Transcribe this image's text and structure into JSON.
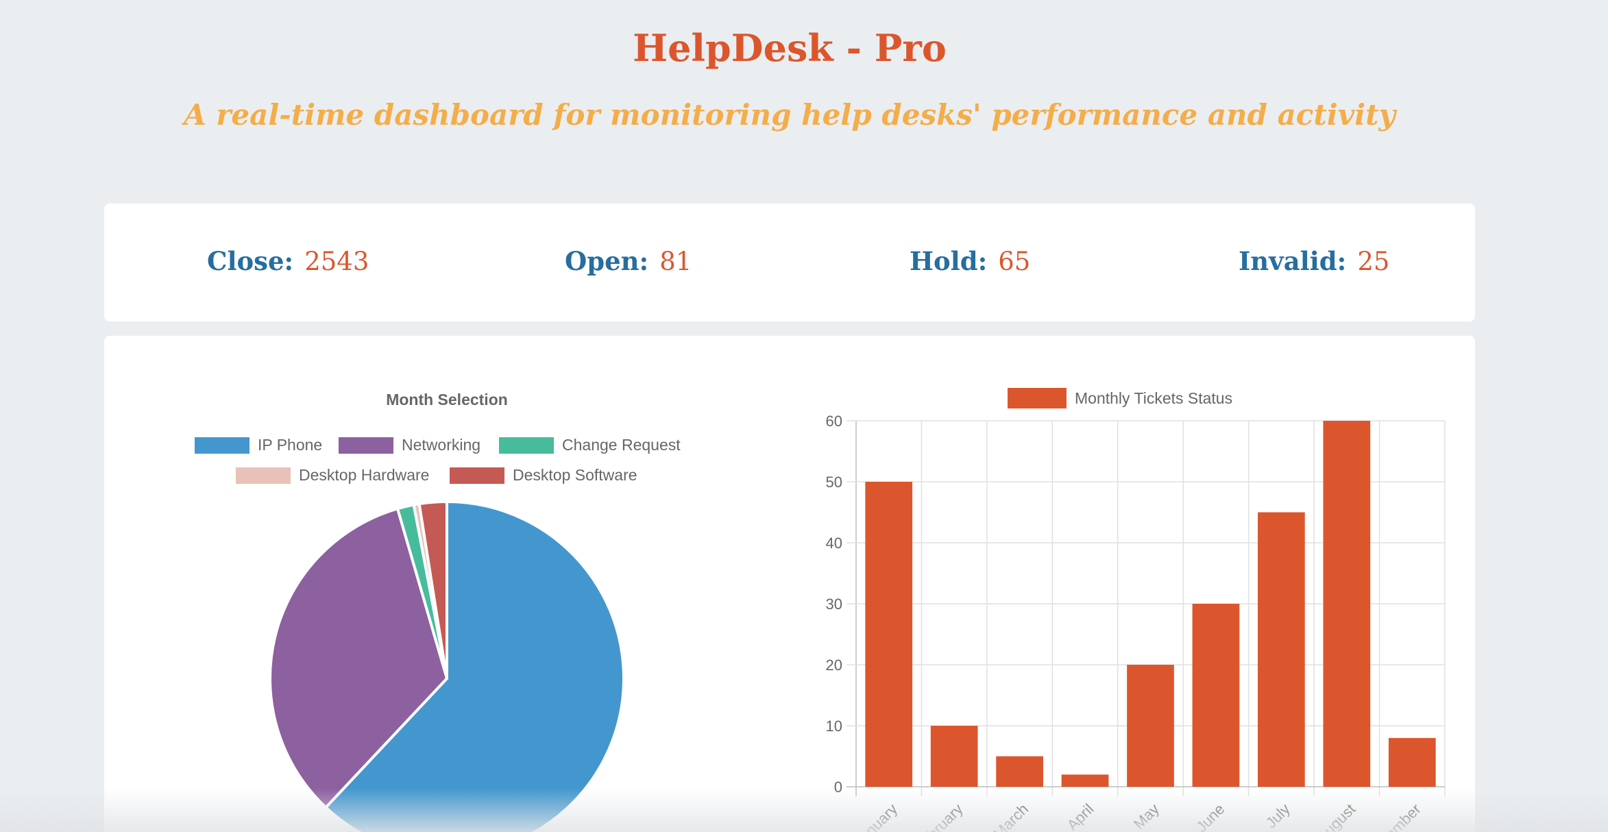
{
  "header": {
    "title": "HelpDesk - Pro",
    "subtitle": "A real-time dashboard for monitoring help desks' performance and activity"
  },
  "stats": [
    {
      "label": "Close:",
      "value": "2543"
    },
    {
      "label": "Open:",
      "value": "81"
    },
    {
      "label": "Hold:",
      "value": "65"
    },
    {
      "label": "Invalid:",
      "value": "25"
    }
  ],
  "colors": {
    "accent": "#dc562d",
    "subtitle": "#f4ad49",
    "label": "#266e9f",
    "bar": "#dc562d"
  },
  "chart_data": [
    {
      "type": "pie",
      "title": "Month Selection",
      "categories": [
        "IP Phone",
        "Networking",
        "Change Request",
        "Desktop Hardware",
        "Desktop Software"
      ],
      "values": [
        62,
        33.5,
        1.5,
        0.5,
        2.5
      ],
      "colors": [
        "#4397ce",
        "#8d60a0",
        "#47bc9c",
        "#e8c2b8",
        "#c55a55"
      ],
      "legend_position": "top"
    },
    {
      "type": "bar",
      "categories": [
        "January",
        "February",
        "March",
        "April",
        "May",
        "June",
        "July",
        "August",
        "September"
      ],
      "tick_labels": [
        "anuary",
        "bruary",
        "March",
        "April",
        "May",
        "June",
        "July",
        "August",
        "ember"
      ],
      "series": [
        {
          "name": "Monthly Tickets Status",
          "values": [
            50,
            10,
            5,
            2,
            20,
            30,
            45,
            60,
            8
          ],
          "color": "#dc562d"
        }
      ],
      "ylim": [
        0,
        60
      ],
      "yticks": [
        0,
        10,
        20,
        30,
        40,
        50,
        60
      ],
      "grid": true,
      "legend_position": "top"
    }
  ]
}
